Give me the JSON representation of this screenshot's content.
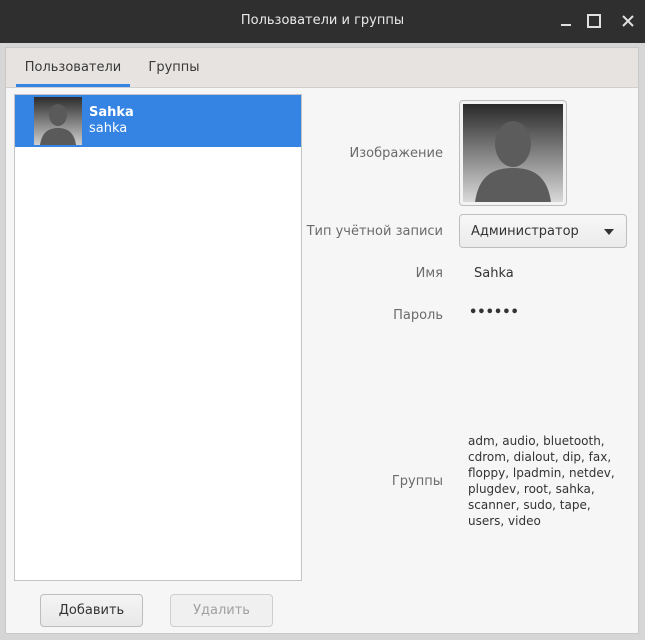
{
  "window": {
    "title": "Пользователи и группы"
  },
  "tabs": [
    {
      "label": "Пользователи",
      "active": true
    },
    {
      "label": "Группы",
      "active": false
    }
  ],
  "users": [
    {
      "display_name": "Sahka",
      "login": "sahka",
      "selected": true
    }
  ],
  "buttons": {
    "add_label": "Добавить",
    "delete_label": "Удалить"
  },
  "details": {
    "image_label": "Изображение",
    "account_type_label": "Тип учётной записи",
    "account_type_value": "Администратор",
    "name_label": "Имя",
    "name_value": "Sahka",
    "password_label": "Пароль",
    "password_value": "••••••",
    "groups_label": "Группы",
    "groups_value": "adm, audio, bluetooth, cdrom, dialout, dip, fax, floppy, lpadmin, netdev, plugdev, root, sahka, scanner, sudo, tape, users, video"
  },
  "colors": {
    "accent": "#3584e4",
    "titlebar": "#2f2f2f"
  },
  "icons": {
    "minimize": "minimize-icon",
    "maximize": "maximize-icon",
    "close": "close-icon",
    "avatar": "avatar-silhouette-icon",
    "dropdown": "chevron-down-icon"
  }
}
